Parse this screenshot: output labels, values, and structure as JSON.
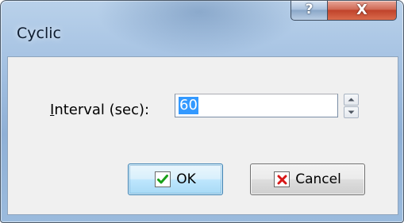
{
  "window": {
    "title": "Cyclic",
    "help_glyph": "?",
    "close_glyph": "X"
  },
  "form": {
    "interval_label_accel": "I",
    "interval_label_rest": "nterval (sec):",
    "interval_value": "60"
  },
  "buttons": {
    "ok_label": "OK",
    "cancel_label": "Cancel",
    "ok_icon": "check-icon",
    "cancel_icon": "x-icon"
  },
  "colors": {
    "check": "#18a018",
    "cross": "#d81818",
    "selection": "#3399ff"
  }
}
